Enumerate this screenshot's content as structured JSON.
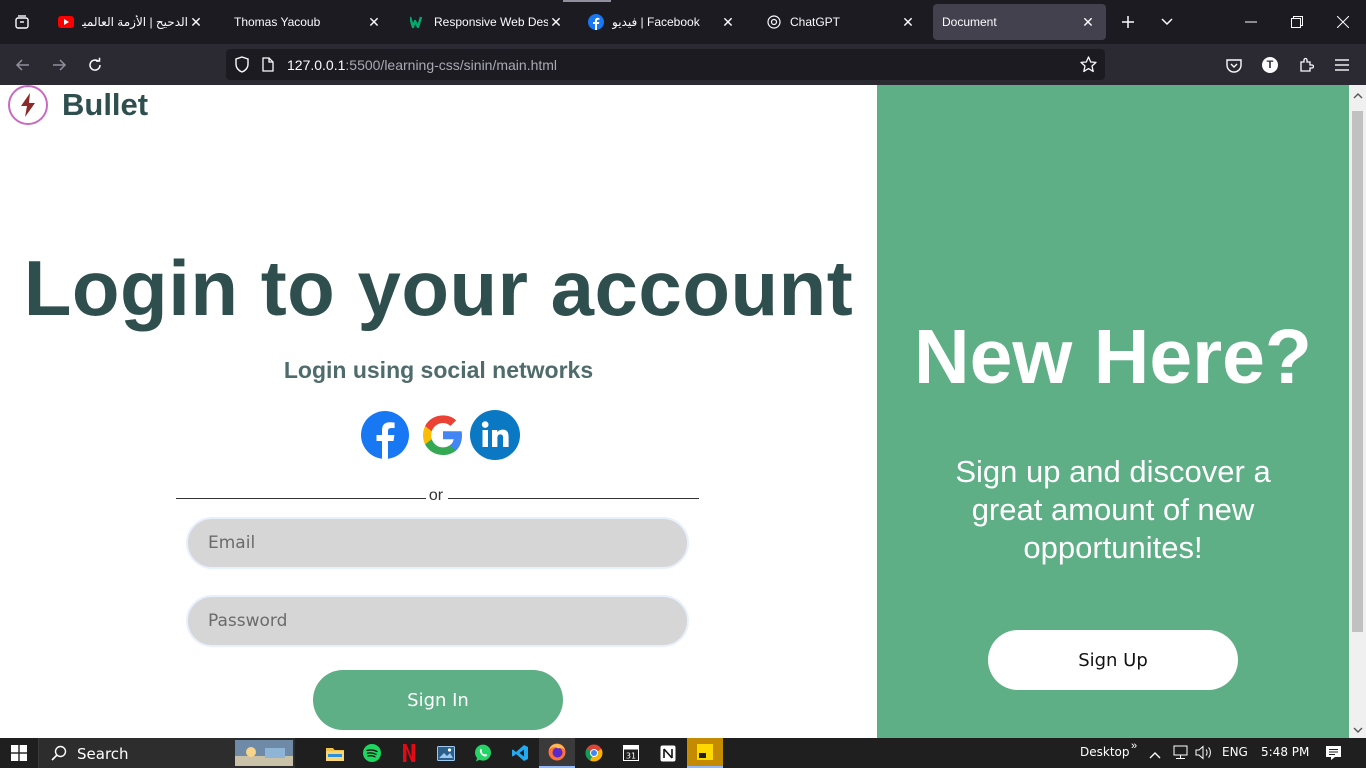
{
  "browser": {
    "tabs": [
      {
        "label": "الدحيح | الأزمة العالمية",
        "favicon": "youtube-icon",
        "active": false
      },
      {
        "label": "Thomas Yacoub",
        "favicon": "none",
        "active": false
      },
      {
        "label": "Responsive Web Desig",
        "favicon": "w3-icon",
        "active": false
      },
      {
        "label": "فيديو | Facebook",
        "favicon": "facebook-icon",
        "active": false
      },
      {
        "label": "ChatGPT",
        "favicon": "openai-icon",
        "active": false
      },
      {
        "label": "Document",
        "favicon": "none",
        "active": true
      }
    ],
    "url": {
      "host": "127.0.0.1",
      "path": ":5500/learning-css/sinin/main.html"
    }
  },
  "page": {
    "brand": {
      "name": "Bullet",
      "logo": "lightning-bolt-icon"
    },
    "login": {
      "title": "Login to your account",
      "social_heading": "Login using social networks",
      "social_icons": [
        "facebook-icon",
        "google-icon",
        "linkedin-icon"
      ],
      "divider_text": "or",
      "email_placeholder": "Email",
      "password_placeholder": "Password",
      "signin_label": "Sign In"
    },
    "signup_panel": {
      "title": "New Here?",
      "text": "Sign up and discover a great amount of new opportunites!",
      "button_label": "Sign Up"
    }
  },
  "taskbar": {
    "search_label": "Search",
    "desktop_label": "Desktop",
    "language": "ENG",
    "time": "5:48 PM",
    "apps": [
      "file-explorer-icon",
      "spotify-icon",
      "netflix-icon",
      "photos-icon",
      "whatsapp-icon",
      "vscode-icon",
      "firefox-icon",
      "chrome-icon",
      "calendar-icon",
      "notion-icon",
      "sticky-notes-icon"
    ]
  },
  "colors": {
    "accent_green": "#5eae86",
    "heading_dark": "#2f4f4f",
    "browser_dark": "#1c1b22"
  }
}
